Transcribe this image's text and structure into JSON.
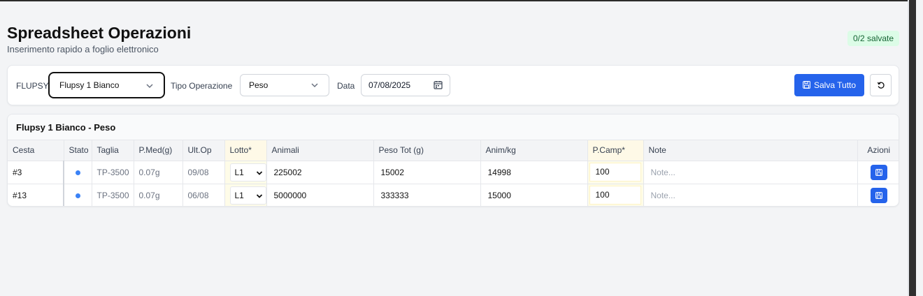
{
  "page": {
    "title": "Spreadsheet Operazioni",
    "subtitle": "Inserimento rapido a foglio elettronico",
    "badge": "0/2 salvate"
  },
  "toolbar": {
    "flupsy_label": "FLUPSY",
    "flupsy_value": "Flupsy 1 Bianco",
    "tipo_label": "Tipo Operazione",
    "tipo_value": "Peso",
    "data_label": "Data",
    "data_value": "07/08/2025",
    "save_all_label": "Salva Tutto",
    "icons": {
      "save": "save-icon",
      "reset": "rotate-ccw-icon",
      "calendar": "calendar-icon",
      "chevron": "chevron-down-icon"
    }
  },
  "table": {
    "title": "Flupsy 1 Bianco - Peso",
    "columns": [
      "Cesta",
      "Stato",
      "Taglia",
      "P.Med(g)",
      "Ult.Op",
      "Lotto*",
      "Animali",
      "Peso Tot (g)",
      "Anim/kg",
      "P.Camp*",
      "Note",
      "Azioni"
    ],
    "rows": [
      {
        "cesta": "#3",
        "taglia": "TP-3500",
        "pmed": "0.07g",
        "ultop": "09/08",
        "lotto": "L1",
        "animali": "225002",
        "peso_tot": "15002",
        "anim_kg": "14998",
        "pcamp": "100",
        "note_placeholder": "Note..."
      },
      {
        "cesta": "#13",
        "taglia": "TP-3500",
        "pmed": "0.07g",
        "ultop": "06/08",
        "lotto": "L1",
        "animali": "5000000",
        "peso_tot": "333333",
        "anim_kg": "15000",
        "pcamp": "100",
        "note_placeholder": "Note..."
      }
    ]
  },
  "colors": {
    "accent": "#2563eb",
    "status_dot": "#3b82f6",
    "badge_bg": "#dcfce7",
    "badge_text": "#166534",
    "required_bg": "#fef9e7"
  }
}
